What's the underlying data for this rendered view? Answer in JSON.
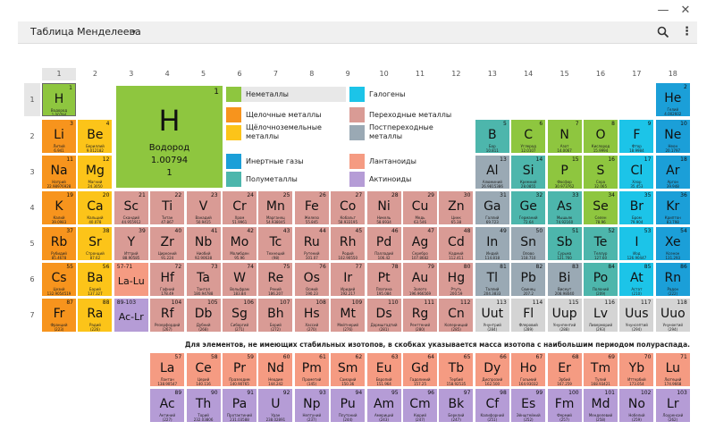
{
  "window": {
    "minimize_glyph": "—",
    "close_glyph": "✕"
  },
  "toolbar": {
    "title": "Таблица Менделеева",
    "dropdown_glyph": "▾",
    "menu_glyph": "⋮",
    "search_icon": "search-icon"
  },
  "columns": [
    "1",
    "2",
    "3",
    "4",
    "5",
    "6",
    "7",
    "8",
    "9",
    "10",
    "11",
    "12",
    "13",
    "14",
    "15",
    "16",
    "17",
    "18"
  ],
  "rows": [
    "1",
    "2",
    "3",
    "4",
    "5",
    "6",
    "7"
  ],
  "colors": {
    "nonmetal": "#8ec63f",
    "alkali": "#f7941d",
    "alkaline_earth": "#fcc419",
    "noble": "#1b9fd8",
    "metalloid": "#4db6ac",
    "halogen": "#1cc4e8",
    "transition": "#d99b95",
    "post_transition": "#9aa9b4",
    "lanthanide": "#f59b82",
    "actinide": "#b59cd6",
    "unknown": "#d4d4d4"
  },
  "detail": {
    "number": "1",
    "symbol": "H",
    "name": "Водород",
    "mass": "1.00794",
    "valence": "1"
  },
  "legend": [
    {
      "label": "Неметаллы",
      "color": "#8ec63f"
    },
    {
      "label": "Щелочные металлы",
      "color": "#f7941d"
    },
    {
      "label": "Щёлочноземельные металлы",
      "color": "#fcc419"
    },
    {
      "label": "Инертные газы",
      "color": "#1b9fd8"
    },
    {
      "label": "Полуметаллы",
      "color": "#4db6ac"
    },
    {
      "label": "Галогены",
      "color": "#1cc4e8"
    },
    {
      "label": "Переходные металлы",
      "color": "#d99b95"
    },
    {
      "label": "Постпереходные металлы",
      "color": "#9aa9b4"
    },
    {
      "label": "Лантаноиды",
      "color": "#f59b82"
    },
    {
      "label": "Актиноиды",
      "color": "#b59cd6"
    }
  ],
  "note": "Для элементов, не имеющих стабильных изотопов, в скобках указывается масса изотопа с наибольшим периодом полураспада.",
  "elements": [
    {
      "n": "1",
      "s": "H",
      "name": "Водород",
      "m": "1.00794",
      "r": 1,
      "c": 1,
      "cat": "nonmetal"
    },
    {
      "n": "2",
      "s": "He",
      "name": "Гелий",
      "m": "4.002602",
      "r": 1,
      "c": 18,
      "cat": "noble"
    },
    {
      "n": "3",
      "s": "Li",
      "name": "Литий",
      "m": "6.941",
      "r": 2,
      "c": 1,
      "cat": "alkali"
    },
    {
      "n": "4",
      "s": "Be",
      "name": "Бериллий",
      "m": "9.012182",
      "r": 2,
      "c": 2,
      "cat": "alkaline_earth"
    },
    {
      "n": "5",
      "s": "B",
      "name": "Бор",
      "m": "10.811",
      "r": 2,
      "c": 13,
      "cat": "metalloid"
    },
    {
      "n": "6",
      "s": "C",
      "name": "Углерод",
      "m": "12.0107",
      "r": 2,
      "c": 14,
      "cat": "nonmetal"
    },
    {
      "n": "7",
      "s": "N",
      "name": "Азот",
      "m": "14.0067",
      "r": 2,
      "c": 15,
      "cat": "nonmetal"
    },
    {
      "n": "8",
      "s": "O",
      "name": "Кислород",
      "m": "15.9994",
      "r": 2,
      "c": 16,
      "cat": "nonmetal"
    },
    {
      "n": "9",
      "s": "F",
      "name": "Фтор",
      "m": "18.9984",
      "r": 2,
      "c": 17,
      "cat": "halogen"
    },
    {
      "n": "10",
      "s": "Ne",
      "name": "Неон",
      "m": "20.1797",
      "r": 2,
      "c": 18,
      "cat": "noble"
    },
    {
      "n": "11",
      "s": "Na",
      "name": "Натрий",
      "m": "22.98976928",
      "r": 3,
      "c": 1,
      "cat": "alkali"
    },
    {
      "n": "12",
      "s": "Mg",
      "name": "Магний",
      "m": "24.3050",
      "r": 3,
      "c": 2,
      "cat": "alkaline_earth"
    },
    {
      "n": "13",
      "s": "Al",
      "name": "Алюминий",
      "m": "26.9815386",
      "r": 3,
      "c": 13,
      "cat": "post_transition"
    },
    {
      "n": "14",
      "s": "Si",
      "name": "Кремний",
      "m": "28.0855",
      "r": 3,
      "c": 14,
      "cat": "metalloid"
    },
    {
      "n": "15",
      "s": "P",
      "name": "Фосфор",
      "m": "30.973762",
      "r": 3,
      "c": 15,
      "cat": "nonmetal"
    },
    {
      "n": "16",
      "s": "S",
      "name": "Сера",
      "m": "32.065",
      "r": 3,
      "c": 16,
      "cat": "nonmetal"
    },
    {
      "n": "17",
      "s": "Cl",
      "name": "Хлор",
      "m": "35.453",
      "r": 3,
      "c": 17,
      "cat": "halogen"
    },
    {
      "n": "18",
      "s": "Ar",
      "name": "Аргон",
      "m": "39.948",
      "r": 3,
      "c": 18,
      "cat": "noble"
    },
    {
      "n": "19",
      "s": "K",
      "name": "Калий",
      "m": "39.0983",
      "r": 4,
      "c": 1,
      "cat": "alkali"
    },
    {
      "n": "20",
      "s": "Ca",
      "name": "Кальций",
      "m": "40.078",
      "r": 4,
      "c": 2,
      "cat": "alkaline_earth"
    },
    {
      "n": "21",
      "s": "Sc",
      "name": "Скандий",
      "m": "44.955912",
      "r": 4,
      "c": 3,
      "cat": "transition"
    },
    {
      "n": "22",
      "s": "Ti",
      "name": "Титан",
      "m": "47.867",
      "r": 4,
      "c": 4,
      "cat": "transition"
    },
    {
      "n": "23",
      "s": "V",
      "name": "Ванадий",
      "m": "50.9415",
      "r": 4,
      "c": 5,
      "cat": "transition"
    },
    {
      "n": "24",
      "s": "Cr",
      "name": "Хром",
      "m": "51.9961",
      "r": 4,
      "c": 6,
      "cat": "transition"
    },
    {
      "n": "25",
      "s": "Mn",
      "name": "Марганец",
      "m": "54.938045",
      "r": 4,
      "c": 7,
      "cat": "transition"
    },
    {
      "n": "26",
      "s": "Fe",
      "name": "Железо",
      "m": "55.845",
      "r": 4,
      "c": 8,
      "cat": "transition"
    },
    {
      "n": "27",
      "s": "Co",
      "name": "Кобальт",
      "m": "58.933195",
      "r": 4,
      "c": 9,
      "cat": "transition"
    },
    {
      "n": "28",
      "s": "Ni",
      "name": "Никель",
      "m": "58.6934",
      "r": 4,
      "c": 10,
      "cat": "transition"
    },
    {
      "n": "29",
      "s": "Cu",
      "name": "Медь",
      "m": "63.546",
      "r": 4,
      "c": 11,
      "cat": "transition"
    },
    {
      "n": "30",
      "s": "Zn",
      "name": "Цинк",
      "m": "65.38",
      "r": 4,
      "c": 12,
      "cat": "transition"
    },
    {
      "n": "31",
      "s": "Ga",
      "name": "Галлий",
      "m": "69.723",
      "r": 4,
      "c": 13,
      "cat": "post_transition"
    },
    {
      "n": "32",
      "s": "Ge",
      "name": "Германий",
      "m": "72.64",
      "r": 4,
      "c": 14,
      "cat": "metalloid"
    },
    {
      "n": "33",
      "s": "As",
      "name": "Мышьяк",
      "m": "74.92160",
      "r": 4,
      "c": 15,
      "cat": "metalloid"
    },
    {
      "n": "34",
      "s": "Se",
      "name": "Селен",
      "m": "78.96",
      "r": 4,
      "c": 16,
      "cat": "nonmetal"
    },
    {
      "n": "35",
      "s": "Br",
      "name": "Бром",
      "m": "79.904",
      "r": 4,
      "c": 17,
      "cat": "halogen"
    },
    {
      "n": "36",
      "s": "Kr",
      "name": "Криптон",
      "m": "83.798",
      "r": 4,
      "c": 18,
      "cat": "noble"
    },
    {
      "n": "37",
      "s": "Rb",
      "name": "Рубидий",
      "m": "85.4678",
      "r": 5,
      "c": 1,
      "cat": "alkali"
    },
    {
      "n": "38",
      "s": "Sr",
      "name": "Стронций",
      "m": "87.62",
      "r": 5,
      "c": 2,
      "cat": "alkaline_earth"
    },
    {
      "n": "39",
      "s": "Y",
      "name": "Иттрий",
      "m": "88.90585",
      "r": 5,
      "c": 3,
      "cat": "transition"
    },
    {
      "n": "40",
      "s": "Zr",
      "name": "Цирконий",
      "m": "91.224",
      "r": 5,
      "c": 4,
      "cat": "transition"
    },
    {
      "n": "41",
      "s": "Nb",
      "name": "Ниобий",
      "m": "92.90638",
      "r": 5,
      "c": 5,
      "cat": "transition"
    },
    {
      "n": "42",
      "s": "Mo",
      "name": "Молибден",
      "m": "95.96",
      "r": 5,
      "c": 6,
      "cat": "transition"
    },
    {
      "n": "43",
      "s": "Tc",
      "name": "Технеций",
      "m": "(98)",
      "r": 5,
      "c": 7,
      "cat": "transition"
    },
    {
      "n": "44",
      "s": "Ru",
      "name": "Рутений",
      "m": "101.07",
      "r": 5,
      "c": 8,
      "cat": "transition"
    },
    {
      "n": "45",
      "s": "Rh",
      "name": "Родий",
      "m": "102.90550",
      "r": 5,
      "c": 9,
      "cat": "transition"
    },
    {
      "n": "46",
      "s": "Pd",
      "name": "Палладий",
      "m": "106.42",
      "r": 5,
      "c": 10,
      "cat": "transition"
    },
    {
      "n": "47",
      "s": "Ag",
      "name": "Серебро",
      "m": "107.8682",
      "r": 5,
      "c": 11,
      "cat": "transition"
    },
    {
      "n": "48",
      "s": "Cd",
      "name": "Кадмий",
      "m": "112.411",
      "r": 5,
      "c": 12,
      "cat": "transition"
    },
    {
      "n": "49",
      "s": "In",
      "name": "Индий",
      "m": "114.818",
      "r": 5,
      "c": 13,
      "cat": "post_transition"
    },
    {
      "n": "50",
      "s": "Sn",
      "name": "Олово",
      "m": "118.710",
      "r": 5,
      "c": 14,
      "cat": "post_transition"
    },
    {
      "n": "51",
      "s": "Sb",
      "name": "Сурьма",
      "m": "121.760",
      "r": 5,
      "c": 15,
      "cat": "metalloid"
    },
    {
      "n": "52",
      "s": "Te",
      "name": "Теллур",
      "m": "127.60",
      "r": 5,
      "c": 16,
      "cat": "metalloid"
    },
    {
      "n": "53",
      "s": "I",
      "name": "Иод",
      "m": "126.90447",
      "r": 5,
      "c": 17,
      "cat": "halogen"
    },
    {
      "n": "54",
      "s": "Xe",
      "name": "Ксенон",
      "m": "131.293",
      "r": 5,
      "c": 18,
      "cat": "noble"
    },
    {
      "n": "55",
      "s": "Cs",
      "name": "Цезий",
      "m": "132.9054519",
      "r": 6,
      "c": 1,
      "cat": "alkali"
    },
    {
      "n": "56",
      "s": "Ba",
      "name": "Барий",
      "m": "137.327",
      "r": 6,
      "c": 2,
      "cat": "alkaline_earth"
    },
    {
      "n": "57-71",
      "s": "La-Lu",
      "name": "",
      "m": "",
      "r": 6,
      "c": 3,
      "cat": "lanthanide",
      "range": true
    },
    {
      "n": "72",
      "s": "Hf",
      "name": "Гафний",
      "m": "178.49",
      "r": 6,
      "c": 4,
      "cat": "transition"
    },
    {
      "n": "73",
      "s": "Ta",
      "name": "Тантал",
      "m": "180.94788",
      "r": 6,
      "c": 5,
      "cat": "transition"
    },
    {
      "n": "74",
      "s": "W",
      "name": "Вольфрам",
      "m": "183.84",
      "r": 6,
      "c": 6,
      "cat": "transition"
    },
    {
      "n": "75",
      "s": "Re",
      "name": "Рений",
      "m": "186.207",
      "r": 6,
      "c": 7,
      "cat": "transition"
    },
    {
      "n": "76",
      "s": "Os",
      "name": "Осмий",
      "m": "190.23",
      "r": 6,
      "c": 8,
      "cat": "transition"
    },
    {
      "n": "77",
      "s": "Ir",
      "name": "Иридий",
      "m": "192.217",
      "r": 6,
      "c": 9,
      "cat": "transition"
    },
    {
      "n": "78",
      "s": "Pt",
      "name": "Платина",
      "m": "195.084",
      "r": 6,
      "c": 10,
      "cat": "transition"
    },
    {
      "n": "79",
      "s": "Au",
      "name": "Золото",
      "m": "196.966569",
      "r": 6,
      "c": 11,
      "cat": "transition"
    },
    {
      "n": "80",
      "s": "Hg",
      "name": "Ртуть",
      "m": "200.59",
      "r": 6,
      "c": 12,
      "cat": "transition"
    },
    {
      "n": "81",
      "s": "Tl",
      "name": "Таллий",
      "m": "204.3833",
      "r": 6,
      "c": 13,
      "cat": "post_transition"
    },
    {
      "n": "82",
      "s": "Pb",
      "name": "Свинец",
      "m": "207.2",
      "r": 6,
      "c": 14,
      "cat": "post_transition"
    },
    {
      "n": "83",
      "s": "Bi",
      "name": "Висмут",
      "m": "208.98040",
      "r": 6,
      "c": 15,
      "cat": "post_transition"
    },
    {
      "n": "84",
      "s": "Po",
      "name": "Полоний",
      "m": "(209)",
      "r": 6,
      "c": 16,
      "cat": "metalloid"
    },
    {
      "n": "85",
      "s": "At",
      "name": "Астат",
      "m": "(210)",
      "r": 6,
      "c": 17,
      "cat": "halogen"
    },
    {
      "n": "86",
      "s": "Rn",
      "name": "Радон",
      "m": "(222)",
      "r": 6,
      "c": 18,
      "cat": "noble"
    },
    {
      "n": "87",
      "s": "Fr",
      "name": "Франций",
      "m": "(223)",
      "r": 7,
      "c": 1,
      "cat": "alkali"
    },
    {
      "n": "88",
      "s": "Ra",
      "name": "Радий",
      "m": "(226)",
      "r": 7,
      "c": 2,
      "cat": "alkaline_earth"
    },
    {
      "n": "89-103",
      "s": "Ac-Lr",
      "name": "",
      "m": "",
      "r": 7,
      "c": 3,
      "cat": "actinide",
      "range": true
    },
    {
      "n": "104",
      "s": "Rf",
      "name": "Резерфордий",
      "m": "(267)",
      "r": 7,
      "c": 4,
      "cat": "transition"
    },
    {
      "n": "105",
      "s": "Db",
      "name": "Дубний",
      "m": "(268)",
      "r": 7,
      "c": 5,
      "cat": "transition"
    },
    {
      "n": "106",
      "s": "Sg",
      "name": "Сиборгий",
      "m": "(271)",
      "r": 7,
      "c": 6,
      "cat": "transition"
    },
    {
      "n": "107",
      "s": "Bh",
      "name": "Борий",
      "m": "(272)",
      "r": 7,
      "c": 7,
      "cat": "transition"
    },
    {
      "n": "108",
      "s": "Hs",
      "name": "Хассий",
      "m": "(270)",
      "r": 7,
      "c": 8,
      "cat": "transition"
    },
    {
      "n": "109",
      "s": "Mt",
      "name": "Мейтнерий",
      "m": "(276)",
      "r": 7,
      "c": 9,
      "cat": "transition"
    },
    {
      "n": "110",
      "s": "Ds",
      "name": "Дармштадтий",
      "m": "(281)",
      "r": 7,
      "c": 10,
      "cat": "transition"
    },
    {
      "n": "111",
      "s": "Rg",
      "name": "Рентгений",
      "m": "(280)",
      "r": 7,
      "c": 11,
      "cat": "transition"
    },
    {
      "n": "112",
      "s": "Cn",
      "name": "Коперниций",
      "m": "(285)",
      "r": 7,
      "c": 12,
      "cat": "transition"
    },
    {
      "n": "113",
      "s": "Uut",
      "name": "Унунтрий",
      "m": "(284)",
      "r": 7,
      "c": 13,
      "cat": "unknown"
    },
    {
      "n": "114",
      "s": "Fl",
      "name": "Флеровий",
      "m": "(289)",
      "r": 7,
      "c": 14,
      "cat": "unknown"
    },
    {
      "n": "115",
      "s": "Uup",
      "name": "Унунпентий",
      "m": "(288)",
      "r": 7,
      "c": 15,
      "cat": "unknown"
    },
    {
      "n": "116",
      "s": "Lv",
      "name": "Ливерморий",
      "m": "(293)",
      "r": 7,
      "c": 16,
      "cat": "unknown"
    },
    {
      "n": "117",
      "s": "Uus",
      "name": "Унунсептий",
      "m": "(294)",
      "r": 7,
      "c": 17,
      "cat": "unknown"
    },
    {
      "n": "118",
      "s": "Uuo",
      "name": "Унуноктий",
      "m": "(294)",
      "r": 7,
      "c": 18,
      "cat": "unknown"
    },
    {
      "n": "57",
      "s": "La",
      "name": "Лантан",
      "m": "138.90547",
      "r": 9,
      "c": 4,
      "cat": "lanthanide"
    },
    {
      "n": "58",
      "s": "Ce",
      "name": "Церий",
      "m": "140.116",
      "r": 9,
      "c": 5,
      "cat": "lanthanide"
    },
    {
      "n": "59",
      "s": "Pr",
      "name": "Празеодим",
      "m": "140.90765",
      "r": 9,
      "c": 6,
      "cat": "lanthanide"
    },
    {
      "n": "60",
      "s": "Nd",
      "name": "Неодим",
      "m": "144.242",
      "r": 9,
      "c": 7,
      "cat": "lanthanide"
    },
    {
      "n": "61",
      "s": "Pm",
      "name": "Прометий",
      "m": "(145)",
      "r": 9,
      "c": 8,
      "cat": "lanthanide"
    },
    {
      "n": "62",
      "s": "Sm",
      "name": "Самарий",
      "m": "150.36",
      "r": 9,
      "c": 9,
      "cat": "lanthanide"
    },
    {
      "n": "63",
      "s": "Eu",
      "name": "Европий",
      "m": "151.964",
      "r": 9,
      "c": 10,
      "cat": "lanthanide"
    },
    {
      "n": "64",
      "s": "Gd",
      "name": "Гадолиний",
      "m": "157.25",
      "r": 9,
      "c": 11,
      "cat": "lanthanide"
    },
    {
      "n": "65",
      "s": "Tb",
      "name": "Тербий",
      "m": "158.92535",
      "r": 9,
      "c": 12,
      "cat": "lanthanide"
    },
    {
      "n": "66",
      "s": "Dy",
      "name": "Диспрозий",
      "m": "162.500",
      "r": 9,
      "c": 13,
      "cat": "lanthanide"
    },
    {
      "n": "67",
      "s": "Ho",
      "name": "Гольмий",
      "m": "164.93032",
      "r": 9,
      "c": 14,
      "cat": "lanthanide"
    },
    {
      "n": "68",
      "s": "Er",
      "name": "Эрбий",
      "m": "167.259",
      "r": 9,
      "c": 15,
      "cat": "lanthanide"
    },
    {
      "n": "69",
      "s": "Tm",
      "name": "Тулий",
      "m": "168.93421",
      "r": 9,
      "c": 16,
      "cat": "lanthanide"
    },
    {
      "n": "70",
      "s": "Yb",
      "name": "Иттербий",
      "m": "173.054",
      "r": 9,
      "c": 17,
      "cat": "lanthanide"
    },
    {
      "n": "71",
      "s": "Lu",
      "name": "Лютеций",
      "m": "174.9668",
      "r": 9,
      "c": 18,
      "cat": "lanthanide"
    },
    {
      "n": "89",
      "s": "Ac",
      "name": "Актиний",
      "m": "(227)",
      "r": 10,
      "c": 4,
      "cat": "actinide"
    },
    {
      "n": "90",
      "s": "Th",
      "name": "Торий",
      "m": "232.03806",
      "r": 10,
      "c": 5,
      "cat": "actinide"
    },
    {
      "n": "91",
      "s": "Pa",
      "name": "Протактиний",
      "m": "231.03588",
      "r": 10,
      "c": 6,
      "cat": "actinide"
    },
    {
      "n": "92",
      "s": "U",
      "name": "Уран",
      "m": "238.02891",
      "r": 10,
      "c": 7,
      "cat": "actinide"
    },
    {
      "n": "93",
      "s": "Np",
      "name": "Нептуний",
      "m": "(237)",
      "r": 10,
      "c": 8,
      "cat": "actinide"
    },
    {
      "n": "94",
      "s": "Pu",
      "name": "Плутоний",
      "m": "(244)",
      "r": 10,
      "c": 9,
      "cat": "actinide"
    },
    {
      "n": "95",
      "s": "Am",
      "name": "Америций",
      "m": "(243)",
      "r": 10,
      "c": 10,
      "cat": "actinide"
    },
    {
      "n": "96",
      "s": "Cm",
      "name": "Кюрий",
      "m": "(247)",
      "r": 10,
      "c": 11,
      "cat": "actinide"
    },
    {
      "n": "97",
      "s": "Bk",
      "name": "Берклий",
      "m": "(247)",
      "r": 10,
      "c": 12,
      "cat": "actinide"
    },
    {
      "n": "98",
      "s": "Cf",
      "name": "Калифорний",
      "m": "(251)",
      "r": 10,
      "c": 13,
      "cat": "actinide"
    },
    {
      "n": "99",
      "s": "Es",
      "name": "Эйнштейний",
      "m": "(252)",
      "r": 10,
      "c": 14,
      "cat": "actinide"
    },
    {
      "n": "100",
      "s": "Fm",
      "name": "Фермий",
      "m": "(257)",
      "r": 10,
      "c": 15,
      "cat": "actinide"
    },
    {
      "n": "101",
      "s": "Md",
      "name": "Менделевий",
      "m": "(258)",
      "r": 10,
      "c": 16,
      "cat": "actinide"
    },
    {
      "n": "102",
      "s": "No",
      "name": "Нобелий",
      "m": "(259)",
      "r": 10,
      "c": 17,
      "cat": "actinide"
    },
    {
      "n": "103",
      "s": "Lr",
      "name": "Лоуренсий",
      "m": "(262)",
      "r": 10,
      "c": 18,
      "cat": "actinide"
    }
  ]
}
